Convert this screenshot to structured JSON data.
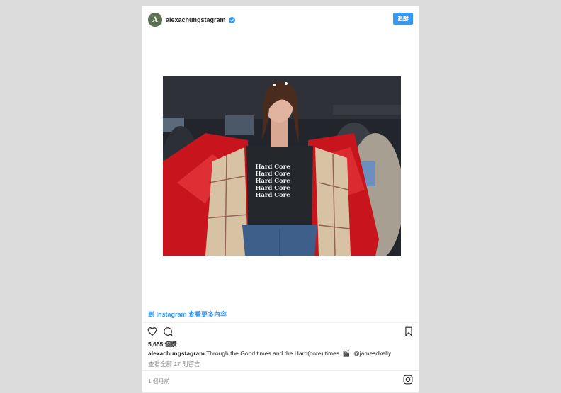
{
  "post": {
    "username": "alexachungstagram",
    "avatar_letter": "A",
    "follow_label": "追蹤",
    "view_more_link": "到 Instagram 查看更多內容",
    "likes": "5,655 個讚",
    "caption_user": "alexachungstagram",
    "caption_text": "Through the Good times and the Hard(core) times. 🎬: @jamesdkelly",
    "comments_link": "查看全部 17 則留言",
    "timestamp": "1 個月前",
    "shirt_text": [
      "Hard Core",
      "Hard Core",
      "Hard Core",
      "Hard Core",
      "Hard Core"
    ]
  },
  "icons": {
    "verified": "verified-badge-icon",
    "like": "heart-icon",
    "comment": "comment-icon",
    "save": "bookmark-icon",
    "brand": "instagram-icon"
  },
  "colors": {
    "accent": "#3897f0",
    "verified": "#3897f0",
    "avatar": "#5b7152",
    "coat": "#c8141c"
  }
}
